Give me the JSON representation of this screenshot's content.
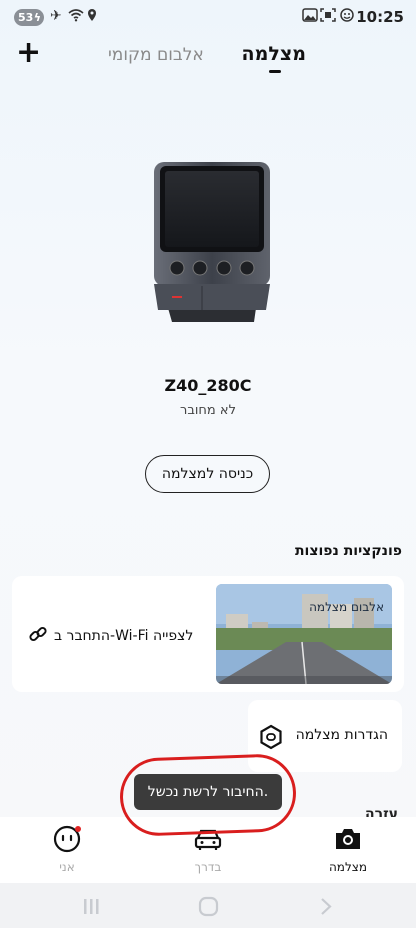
{
  "status_bar": {
    "battery": "53",
    "time": "10:25"
  },
  "header": {
    "tab_camera": "מצלמה",
    "tab_local_album": "אלבום מקומי"
  },
  "device": {
    "name": "Z40_280C",
    "status": "לא מחובר",
    "enter_button": "כניסה למצלמה"
  },
  "functions": {
    "title": "פונקציות נפוצות",
    "wifi_card": {
      "label": "התחבר ב-Wi-Fi לצפייה",
      "thumb_label": "אלבום מצלמה"
    },
    "settings_card": {
      "label": "הגדרות מצלמה"
    },
    "next_section_partial": "עזרה"
  },
  "toast": {
    "message": "החיבור לרשת נכשל."
  },
  "bottom_nav": {
    "me": "אני",
    "on_road": "בדרך",
    "camera": "מצלמה"
  },
  "colors": {
    "accent_red": "#e02424",
    "annotation_red": "#d91e1e"
  }
}
